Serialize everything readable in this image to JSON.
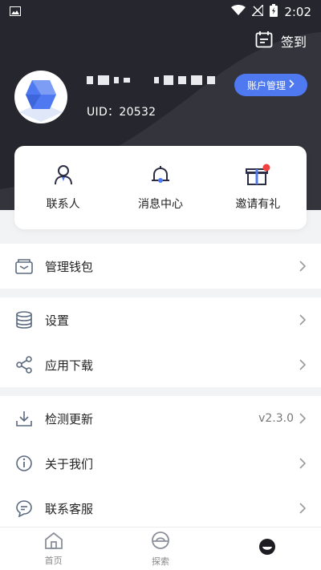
{
  "status_bar": {
    "time": "2:02"
  },
  "header": {
    "checkin_label": "签到",
    "uid": "UID：20532",
    "account_button_label": "账户管理"
  },
  "quick_actions": [
    {
      "label": "联系人"
    },
    {
      "label": "消息中心"
    },
    {
      "label": "邀请有礼"
    }
  ],
  "menu": {
    "group1": [
      {
        "label": "管理钱包"
      }
    ],
    "group2": [
      {
        "label": "设置"
      },
      {
        "label": "应用下载"
      }
    ],
    "group3": [
      {
        "label": "检测更新",
        "value": "v2.3.0"
      },
      {
        "label": "关于我们"
      },
      {
        "label": "联系客服"
      }
    ]
  },
  "bottom_nav": [
    {
      "label": "首页"
    },
    {
      "label": "探索"
    },
    {
      "label": ""
    }
  ],
  "colors": {
    "header_bg": "#26262e",
    "accent": "#4f79f0",
    "badge_red": "#f04040"
  }
}
